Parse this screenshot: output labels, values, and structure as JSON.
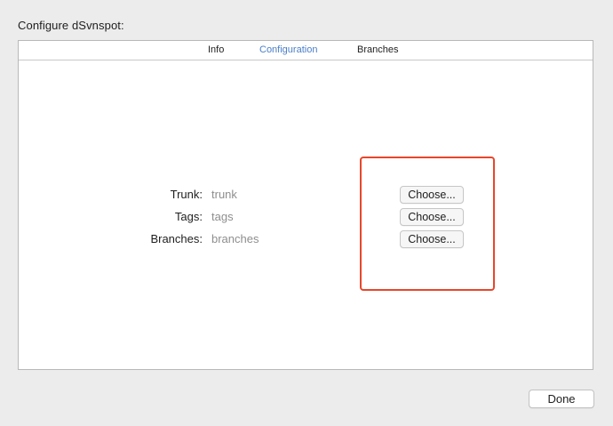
{
  "dialog": {
    "title": "Configure dSvnspot:"
  },
  "tabs": [
    {
      "label": "Info",
      "active": false
    },
    {
      "label": "Configuration",
      "active": true
    },
    {
      "label": "Branches",
      "active": false
    }
  ],
  "config": {
    "rows": [
      {
        "label": "Trunk:",
        "value": "trunk",
        "button": "Choose..."
      },
      {
        "label": "Tags:",
        "value": "tags",
        "button": "Choose..."
      },
      {
        "label": "Branches:",
        "value": "branches",
        "button": "Choose..."
      }
    ]
  },
  "footer": {
    "done_label": "Done"
  },
  "colors": {
    "accent_tab": "#4a7fc9",
    "highlight": "#e8462b",
    "placeholder_text": "#8e8e8e"
  }
}
